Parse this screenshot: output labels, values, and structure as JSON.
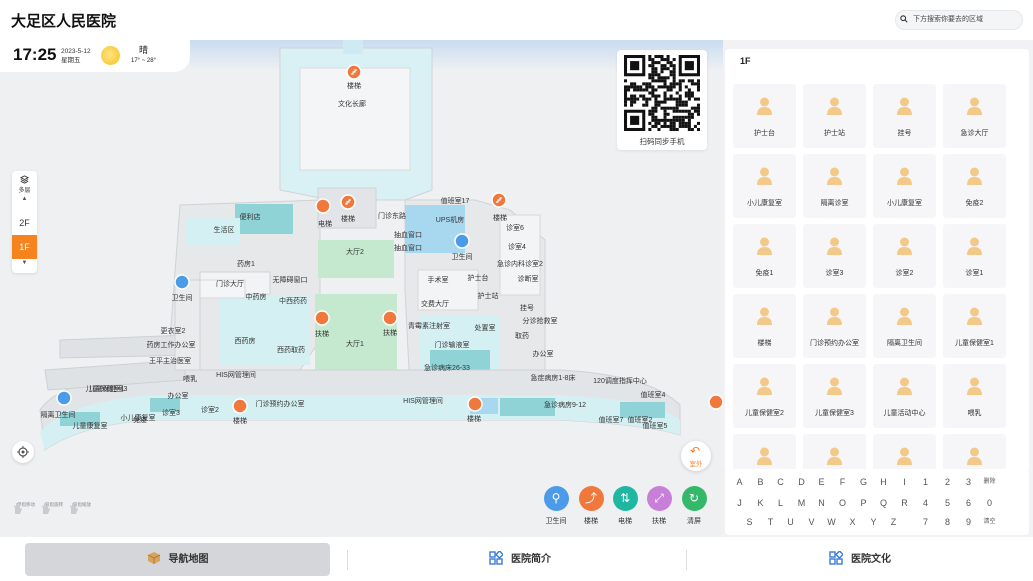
{
  "header": {
    "title": "大足区人民医院",
    "search_placeholder": "下方搜索你要去的区域"
  },
  "status": {
    "time": "17:25",
    "date": "2023-5-12",
    "weekday": "星期五",
    "weather": "晴",
    "temperature": "17° ~ 28°"
  },
  "qr": {
    "caption": "扫码同步手机"
  },
  "floors": {
    "label": "多层",
    "items": [
      "2F",
      "1F"
    ],
    "active": "1F",
    "accent": "#f5841f"
  },
  "map_labels": [
    "楼梯",
    "文化长廊",
    "电梯",
    "楼梯",
    "值班室17",
    "门诊东路",
    "UPS机房",
    "楼梯",
    "抽血窗口",
    "抽血窗口",
    "诊室6",
    "卫生间",
    "诊室4",
    "急诊内科诊室2",
    "诊断室",
    "大厅2",
    "便利店",
    "生活区",
    "药房1",
    "无障碍窗口",
    "卫生间",
    "门诊大厅",
    "中药房",
    "中西药药",
    "手术室",
    "护士台",
    "护士站",
    "挂号",
    "分诊抢救室",
    "取药",
    "办公室",
    "交费大厅",
    "青霉素注射室",
    "处置室",
    "门诊输液室",
    "急诊病床26-33",
    "儿童保健室1",
    "西药房",
    "西药取药",
    "扶梯",
    "扶梯",
    "大厅1",
    "更衣室2",
    "药房工作办公室",
    "王平主治医室",
    "儿童保健室3",
    "喂乳",
    "HIS网管理间",
    "急症病房1-8床",
    "120调度指挥中心",
    "值班室4",
    "隔离卫生间",
    "值班室2",
    "办公室",
    "诊室3",
    "诊室2",
    "门诊预约办公室",
    "楼梯",
    "HIS网管理间",
    "楼梯",
    "急诊病房9-12",
    "值班室7",
    "值班室5",
    "儿童康复室",
    "小儿康复室",
    "免疫"
  ],
  "outdoor_label": "室外",
  "legend": [
    {
      "label": "卫生间",
      "icon": "restroom-icon",
      "color": "#4b9be8"
    },
    {
      "label": "楼梯",
      "icon": "stairs-icon",
      "color": "#f0783c"
    },
    {
      "label": "电梯",
      "icon": "elevator-icon",
      "color": "#1fb7a1"
    },
    {
      "label": "扶梯",
      "icon": "escalator-icon",
      "color": "#c87fd9"
    },
    {
      "label": "清屏",
      "icon": "refresh-icon",
      "color": "#34b96b"
    }
  ],
  "gestures": [
    "单指移动",
    "双指旋转",
    "双指缩放"
  ],
  "rooms_panel": {
    "floor": "1F",
    "rooms": [
      "护士台",
      "护士站",
      "挂号",
      "急诊大厅",
      "小儿康复室",
      "隔离诊室",
      "小儿康复室",
      "免疫2",
      "免疫1",
      "诊室3",
      "诊室2",
      "诊室1",
      "楼梯",
      "门诊预约办公室",
      "隔离卫生间",
      "儿童保健室1",
      "儿童保健室2",
      "儿童保健室3",
      "儿童活动中心",
      "喂乳",
      "",
      "",
      "",
      ""
    ]
  },
  "keyboard": {
    "rows": [
      [
        "A",
        "B",
        "C",
        "D",
        "E",
        "F",
        "G",
        "H",
        "I",
        "1",
        "2",
        "3",
        "删除"
      ],
      [
        "J",
        "K",
        "L",
        "M",
        "N",
        "O",
        "P",
        "Q",
        "R",
        "4",
        "5",
        "6",
        "0"
      ],
      [
        "S",
        "T",
        "U",
        "V",
        "W",
        "X",
        "Y",
        "Z",
        "7",
        "8",
        "9",
        "清空"
      ]
    ]
  },
  "nav": {
    "tabs": [
      {
        "label": "导航地图",
        "active": true
      },
      {
        "label": "医院简介",
        "active": false
      },
      {
        "label": "医院文化",
        "active": false
      }
    ],
    "accent": "#3a7bd5"
  }
}
